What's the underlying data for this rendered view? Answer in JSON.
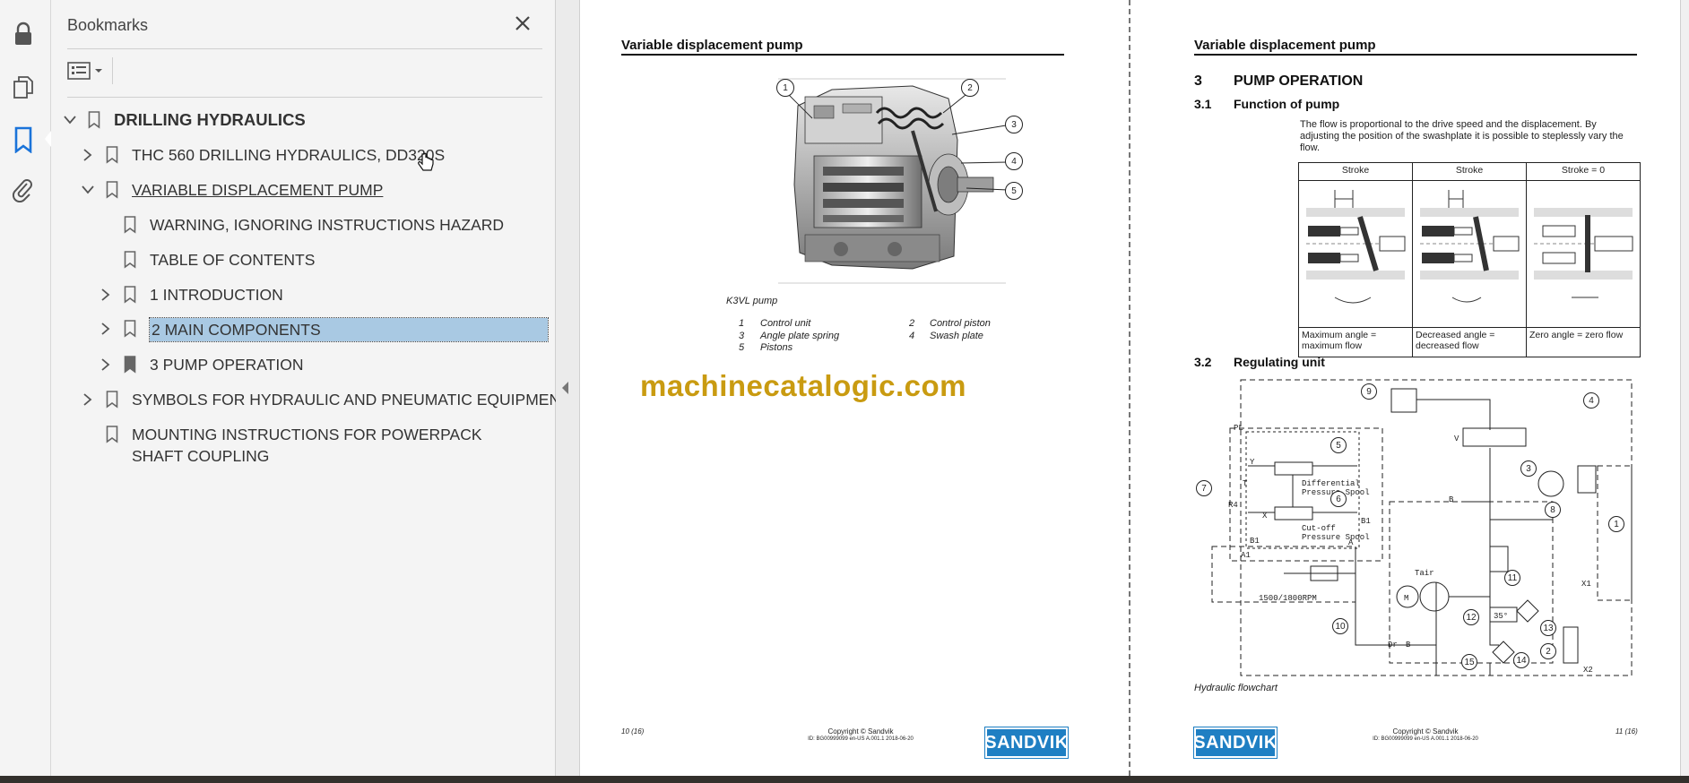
{
  "panel": {
    "title": "Bookmarks",
    "close_icon": "close-icon",
    "options_icon": "list-options-icon"
  },
  "rail": {
    "icons": [
      "lock-icon",
      "pages-icon",
      "bookmark-icon",
      "attachment-icon"
    ]
  },
  "bookmarks": [
    {
      "label": "DRILLING HYDRAULICS",
      "state": "expanded"
    },
    {
      "label": "THC 560 DRILLING HYDRAULICS, DD320S",
      "state": "collapsed"
    },
    {
      "label": "VARIABLE DISPLACEMENT PUMP",
      "state": "expanded"
    },
    {
      "label": "WARNING, IGNORING INSTRUCTIONS HAZARD",
      "state": "leaf"
    },
    {
      "label": "TABLE OF CONTENTS",
      "state": "leaf"
    },
    {
      "label": "1 INTRODUCTION",
      "state": "collapsed"
    },
    {
      "label": "2 MAIN COMPONENTS",
      "state": "collapsed",
      "selected": true
    },
    {
      "label": "3 PUMP OPERATION",
      "state": "collapsed"
    },
    {
      "label": "SYMBOLS FOR HYDRAULIC AND PNEUMATIC EQUIPMENT",
      "state": "collapsed"
    },
    {
      "label": "MOUNTING INSTRUCTIONS FOR POWERPACK SHAFT COUPLING",
      "state": "leaf"
    }
  ],
  "left_page": {
    "header": "Variable displacement pump",
    "figure_caption": "K3VL pump",
    "callouts": [
      "1",
      "2",
      "3",
      "4",
      "5"
    ],
    "legend": [
      {
        "num": "1",
        "text": "Control unit"
      },
      {
        "num": "2",
        "text": "Control piston"
      },
      {
        "num": "3",
        "text": "Angle plate spring"
      },
      {
        "num": "4",
        "text": "Swash plate"
      },
      {
        "num": "5",
        "text": "Pistons"
      }
    ],
    "watermark": "machinecatalogic.com",
    "page_number": "10 (16)",
    "copyright": "Copyright © Sandvik",
    "doc_id": "ID: BG00999099 en-US A.001.1 2018-06-20",
    "logo": "SANDVIK"
  },
  "right_page": {
    "header": "Variable displacement pump",
    "section_num": "3",
    "section_title": "PUMP OPERATION",
    "sub1_num": "3.1",
    "sub1_title": "Function of pump",
    "body": "The flow is proportional to the drive speed and the displacement. By adjusting the position of the swashplate it is possible to steplessly vary the flow.",
    "table_headers": [
      "Stroke",
      "Stroke",
      "Stroke = 0"
    ],
    "table_captions": [
      "Maximum angle = maximum flow",
      "Decreased angle = decreased flow",
      "Zero angle = zero flow"
    ],
    "sub2_num": "3.2",
    "sub2_title": "Regulating unit",
    "diagram_labels": {
      "pl": "PL",
      "y": "Y",
      "t": "T",
      "r4": "R4",
      "x": "X",
      "b1a": "B1",
      "b1b": "B1",
      "a1": "A1",
      "a": "A",
      "b": "B",
      "tair": "Tair",
      "dr": "Dr",
      "b2": "B",
      "rpm": "1500/1800RPM",
      "m": "M",
      "diff": "Differential",
      "diff2": "Pressure Spool",
      "cut": "Cut-off",
      "cut2": "Pressure Spool",
      "v": "V",
      "x1": "X1",
      "x2": "X2",
      "temp": "35°"
    },
    "diagram_callouts": [
      "1",
      "2",
      "3",
      "4",
      "5",
      "6",
      "7",
      "8",
      "9",
      "10",
      "11",
      "12",
      "13",
      "14",
      "15"
    ],
    "figure_caption": "Hydraulic flowchart",
    "page_number": "11 (16)",
    "copyright": "Copyright © Sandvik",
    "doc_id": "ID: BG00999099 en-US A.001.1 2018-06-20",
    "logo": "SANDVIK"
  }
}
